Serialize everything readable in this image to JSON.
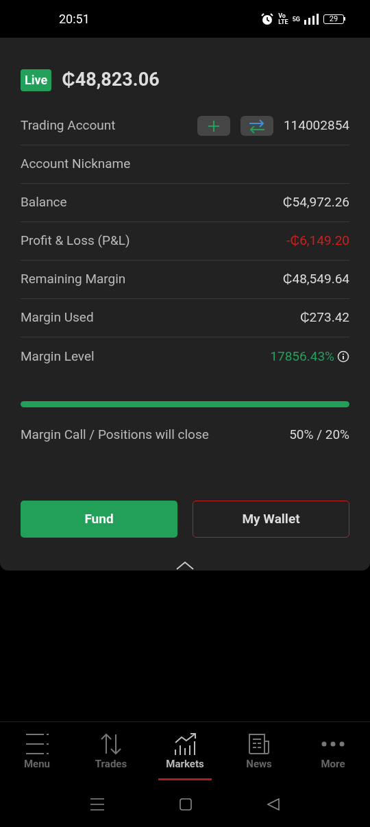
{
  "status_bar": {
    "time": "20:51",
    "volte_top": "Vo",
    "volte_bottom": "LTE",
    "network": "5G",
    "battery": "29"
  },
  "header": {
    "badge": "Live",
    "equity": "₵48,823.06"
  },
  "rows": [
    {
      "kind": "account",
      "label": "Trading Account",
      "value": "114002854",
      "color": "#dddddd"
    },
    {
      "kind": "plain",
      "label": "Account Nickname"
    },
    {
      "kind": "plain",
      "label": "Balance",
      "value": "₵54,972.26",
      "color": "#dddddd"
    },
    {
      "kind": "plain",
      "label": "Profit & Loss (P&L)",
      "value": "-₵6,149.20",
      "color": "#d0201c"
    },
    {
      "kind": "plain",
      "label": "Remaining Margin",
      "value": "₵48,549.64",
      "color": "#dddddd"
    },
    {
      "kind": "plain",
      "label": "Margin Used",
      "value": "₵273.42",
      "color": "#dddddd"
    },
    {
      "kind": "plain",
      "label": "Margin Level",
      "value": "17856.43%",
      "color": "#22a05a",
      "info": true
    }
  ],
  "margin_bar": {
    "level": 1
  },
  "margin_call": {
    "label": "Margin Call / Positions will close",
    "value": "50% / 20%"
  },
  "buttons": [
    {
      "kind": "primary",
      "label": "Fund"
    },
    {
      "kind": "outline",
      "label": "My Wallet"
    }
  ],
  "nav": [
    {
      "label": "Menu",
      "selected": false
    },
    {
      "label": "Trades",
      "selected": false
    },
    {
      "label": "Markets",
      "selected": true
    },
    {
      "label": "News",
      "selected": false
    },
    {
      "label": "More",
      "selected": false
    }
  ]
}
